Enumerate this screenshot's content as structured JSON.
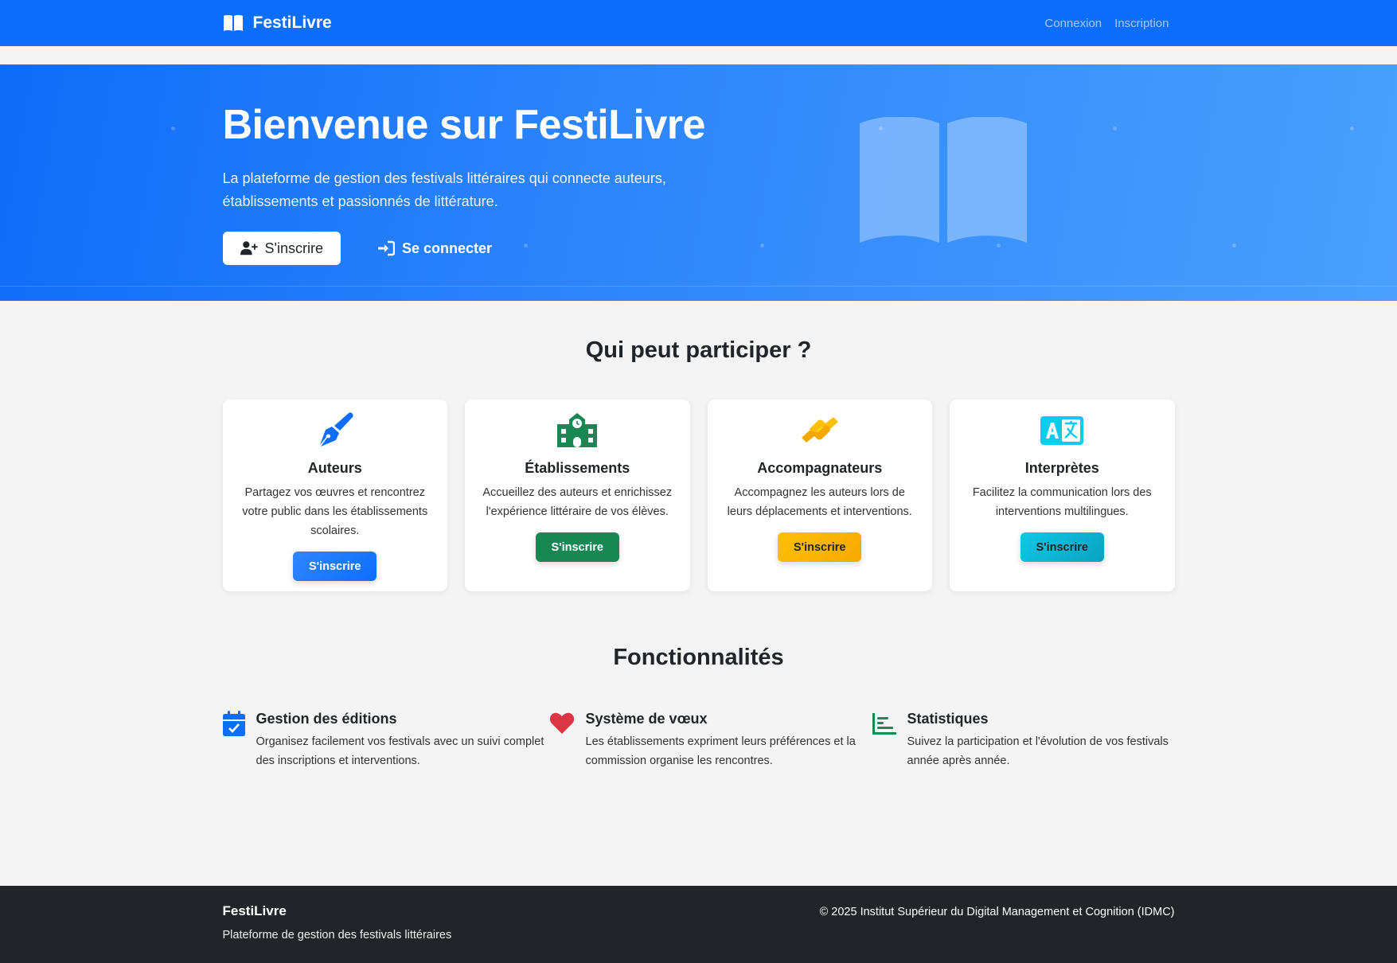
{
  "nav": {
    "brand": "FestiLivre",
    "links": [
      "Connexion",
      "Inscription"
    ]
  },
  "hero": {
    "title": "Bienvenue sur FestiLivre",
    "lead": "La plateforme de gestion des festivals littéraires qui connecte auteurs, établissements et passionnés de littérature.",
    "register_label": "S'inscrire",
    "login_label": "Se connecter"
  },
  "participants": {
    "title": "Qui peut participer ?",
    "cards": [
      {
        "icon": "pen-nib-icon",
        "color": "#0d6efd",
        "title": "Auteurs",
        "text": "Partagez vos œuvres et rencontrez votre public dans les établissements scolaires.",
        "button": "S'inscrire"
      },
      {
        "icon": "school-icon",
        "color": "#198754",
        "title": "Établissements",
        "text": "Accueillez des auteurs et enrichissez l'expérience littéraire de vos élèves.",
        "button": "S'inscrire"
      },
      {
        "icon": "handshake-icon",
        "color": "#ffc107",
        "title": "Accompagnateurs",
        "text": "Accompagnez les auteurs lors de leurs déplacements et interventions.",
        "button": "S'inscrire"
      },
      {
        "icon": "language-icon",
        "color": "#0dcaf0",
        "title": "Interprètes",
        "text": "Facilitez la communication lors des interventions multilingues.",
        "button": "S'inscrire"
      }
    ]
  },
  "features": {
    "title": "Fonctionnalités",
    "items": [
      {
        "icon": "calendar-check-icon",
        "color": "#0d6efd",
        "title": "Gestion des éditions",
        "text": "Organisez facilement vos festivals avec un suivi complet des inscriptions et interventions."
      },
      {
        "icon": "heart-icon",
        "color": "#dc3545",
        "title": "Système de vœux",
        "text": "Les établissements expriment leurs préférences et la commission organise les rencontres."
      },
      {
        "icon": "chart-bar-icon",
        "color": "#198754",
        "title": "Statistiques",
        "text": "Suivez la participation et l'évolution de vos festivals année après année."
      }
    ]
  },
  "footer": {
    "brand": "FestiLivre",
    "tagline": "Plateforme de gestion des festivals littéraires",
    "copyright": "© 2025 Institut Supérieur du Digital Management et Cognition (IDMC)"
  }
}
